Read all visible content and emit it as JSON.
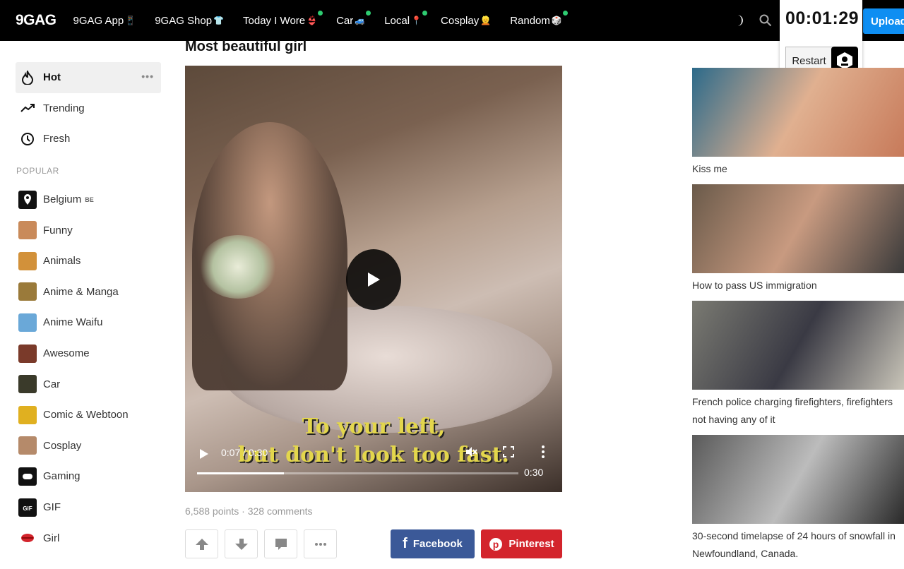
{
  "header": {
    "logo": "9GAG",
    "nav": [
      {
        "label": "9GAG App",
        "emoji": "📱",
        "dot": false
      },
      {
        "label": "9GAG Shop",
        "emoji": "👕",
        "dot": false
      },
      {
        "label": "Today I Wore",
        "emoji": "👙",
        "dot": true
      },
      {
        "label": "Car",
        "emoji": "🚙",
        "dot": true
      },
      {
        "label": "Local",
        "emoji": "📍",
        "dot": true
      },
      {
        "label": "Cosplay",
        "emoji": "👱",
        "dot": false
      },
      {
        "label": "Random",
        "emoji": "🎲",
        "dot": true
      }
    ],
    "upload_label": "Upload"
  },
  "timer": {
    "time": "00:01:29",
    "restart_label": "Restart"
  },
  "sidebar": {
    "main": [
      {
        "label": "Hot",
        "icon": "fire-icon"
      },
      {
        "label": "Trending",
        "icon": "trending-icon"
      },
      {
        "label": "Fresh",
        "icon": "clock-icon"
      }
    ],
    "more": "•••",
    "section_label": "POPULAR",
    "popular": [
      {
        "label": "Belgium",
        "flag": "BE",
        "color": "#111111"
      },
      {
        "label": "Funny",
        "color": "#c98a5a"
      },
      {
        "label": "Animals",
        "color": "#d2913a"
      },
      {
        "label": "Anime & Manga",
        "color": "#9a7a3a"
      },
      {
        "label": "Anime Waifu",
        "color": "#6aa8d8"
      },
      {
        "label": "Awesome",
        "color": "#7a3a2a"
      },
      {
        "label": "Car",
        "color": "#3a3a2a"
      },
      {
        "label": "Comic & Webtoon",
        "color": "#e0b020"
      },
      {
        "label": "Cosplay",
        "color": "#b58a6a"
      },
      {
        "label": "Gaming",
        "color": "#111111"
      },
      {
        "label": "GIF",
        "color": "#111111"
      },
      {
        "label": "Girl",
        "color": "#ffffff"
      }
    ]
  },
  "post": {
    "title": "Most beautiful girl",
    "subtitle_line1": "To your left,",
    "subtitle_line2": "but don't look too fast.",
    "time": "0:07 / 0:30",
    "duration": "0:30",
    "progress": 0.27,
    "meta": "6,588 points · 328 comments",
    "facebook": "Facebook",
    "pinterest": "Pinterest"
  },
  "related": [
    {
      "title": "Kiss me",
      "colors": [
        "#2c6a8a",
        "#e0b090",
        "#c77a5a"
      ]
    },
    {
      "title": "How to pass US immigration",
      "colors": [
        "#6a5a4a",
        "#c89a80",
        "#3a3a3a"
      ]
    },
    {
      "title": "French police charging firefighters, firefighters not having any of it",
      "colors": [
        "#7a7a72",
        "#3a3a44",
        "#c8c4b8"
      ]
    },
    {
      "title": "30-second timelapse of 24 hours of snowfall in Newfoundland, Canada.",
      "colors": [
        "#5a5a5a",
        "#bcbcbc",
        "#2a2a2a"
      ]
    }
  ]
}
